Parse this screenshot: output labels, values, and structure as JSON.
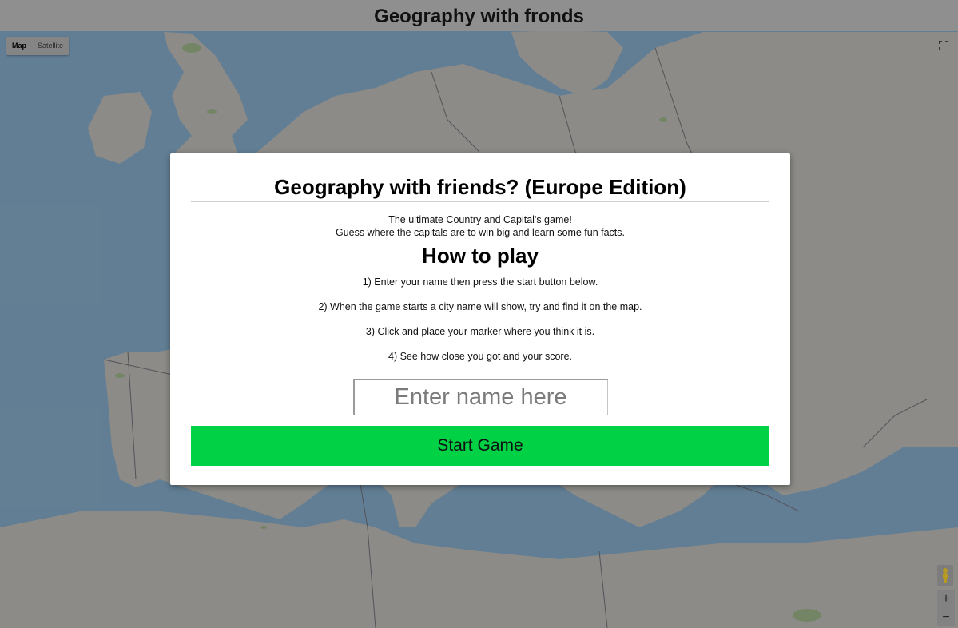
{
  "header": {
    "title": "Geography with fronds"
  },
  "map_controls": {
    "map_type": [
      "Map",
      "Satellite"
    ],
    "selected": "Map",
    "zoom_in": "+",
    "zoom_out": "−",
    "fullscreen_icon": "fullscreen-icon",
    "pegman_icon": "pegman-icon"
  },
  "modal": {
    "title": "Geography with friends? (Europe Edition)",
    "tagline_line1": "The ultimate Country and Capital's game!",
    "tagline_line2": "Guess where the capitals are to win big and learn some fun facts.",
    "how_to_title": "How to play",
    "steps": [
      "1) Enter your name then press the start button below.",
      "2) When the game starts a city name will show, try and find it on the map.",
      "3) Click and place your marker where you think it is.",
      "4) See how close you got and your score."
    ],
    "name_input": {
      "placeholder": "Enter name here",
      "value": ""
    },
    "start_button": "Start Game"
  },
  "colors": {
    "start_button": "#00d145",
    "sea": "#aadaff",
    "land": "#f2efe9",
    "green_area": "#c8e6b0"
  }
}
